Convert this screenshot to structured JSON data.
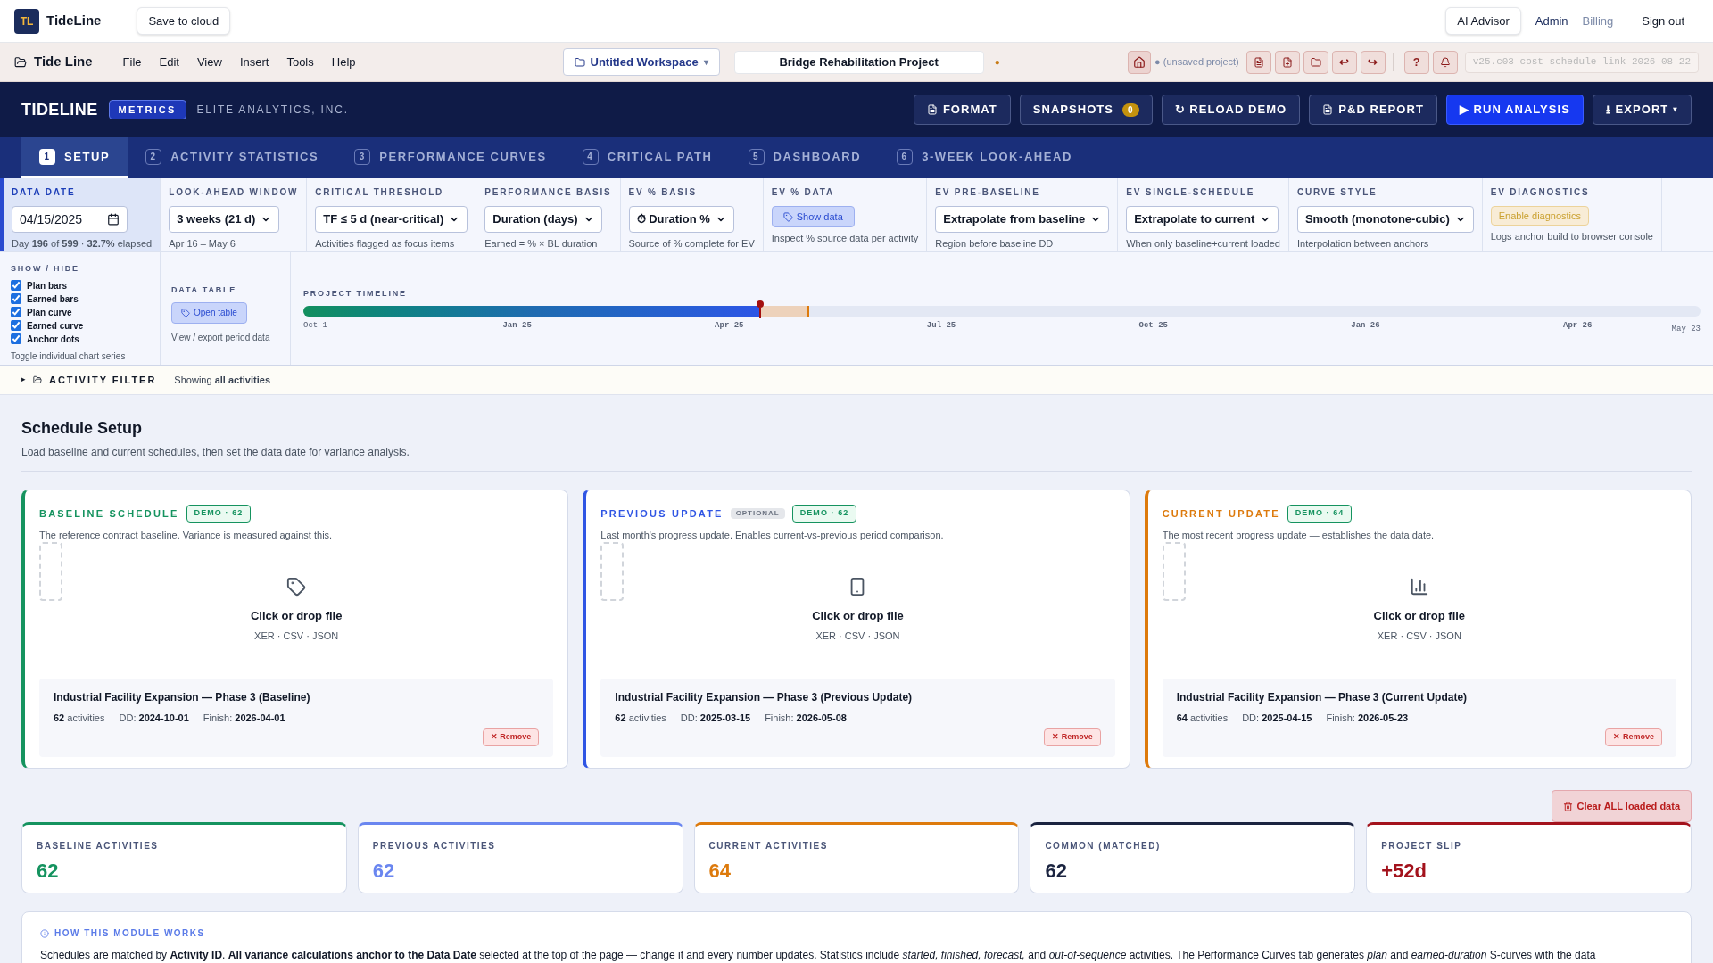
{
  "topbar": {
    "logo": "TL",
    "brand": "TideLine",
    "save_button": "Save to cloud",
    "ai_button": "AI Advisor",
    "links": [
      {
        "label": "Admin",
        "selected": true
      },
      {
        "label": "Billing",
        "selected": false
      }
    ],
    "sign_out": "Sign out"
  },
  "menubar": {
    "app_name": "Tide Line",
    "menus": [
      "File",
      "Edit",
      "View",
      "Insert",
      "Tools",
      "Help"
    ],
    "workspace": "Untitled Workspace",
    "workspace_caret": "▾",
    "project_name": "Bridge Rehabilitation Project",
    "unsaved_dot": "●",
    "status": "● (unsaved project)",
    "tools": [
      {
        "kind": "document"
      },
      {
        "kind": "add-document"
      },
      {
        "kind": "folder"
      },
      {
        "kind": "text",
        "label": "↩"
      },
      {
        "kind": "text",
        "label": "↪"
      },
      {
        "kind": "divider"
      },
      {
        "kind": "text",
        "label": "?"
      },
      {
        "kind": "bell"
      }
    ],
    "version": "v25.c03-cost-schedule-link-2026-08-22"
  },
  "header": {
    "title": "TIDELINE",
    "badge": "METRICS",
    "company": "ELITE ANALYTICS, INC.",
    "buttons": [
      {
        "label": "FORMAT",
        "kind": "icon-doc"
      },
      {
        "label": "SNAPSHOTS",
        "kind": "counter",
        "count": "0"
      },
      {
        "label": "↻ RELOAD DEMO",
        "kind": "plain"
      },
      {
        "label": "P&D REPORT",
        "kind": "icon-doc"
      },
      {
        "label": "▶ RUN ANALYSIS",
        "kind": "primary"
      },
      {
        "label": "⭳ EXPORT ▾",
        "kind": "plain"
      }
    ]
  },
  "tabs": [
    {
      "number": "1",
      "label": "SETUP",
      "selected": true
    },
    {
      "number": "2",
      "label": "ACTIVITY STATISTICS",
      "selected": false
    },
    {
      "number": "3",
      "label": "PERFORMANCE CURVES",
      "selected": false
    },
    {
      "number": "4",
      "label": "CRITICAL PATH",
      "selected": false
    },
    {
      "number": "5",
      "label": "DASHBOARD",
      "selected": false
    },
    {
      "number": "6",
      "label": "3-WEEK LOOK-AHEAD",
      "selected": false
    }
  ],
  "controls": [
    {
      "kind": "date",
      "label": "DATA DATE",
      "value": "04/15/2025",
      "note": "Day **196** of **599** · **32.7%** elapsed"
    },
    {
      "kind": "select",
      "label": "LOOK-AHEAD WINDOW",
      "value": "3 weeks (21 d)",
      "note": "Apr 16 – May 6"
    },
    {
      "kind": "select",
      "label": "CRITICAL THRESHOLD",
      "value": "TF ≤ 5 d (near-critical)",
      "note": "Activities flagged as focus items"
    },
    {
      "kind": "select",
      "label": "PERFORMANCE BASIS",
      "value": "Duration (days)",
      "note": "Earned = % × BL duration"
    },
    {
      "kind": "select",
      "label": "EV % BASIS",
      "value": "⏱ Duration %",
      "note": "Source of % complete for EV"
    },
    {
      "kind": "button",
      "label": "EV % DATA",
      "value": "Show data",
      "note": "Inspect % source data per activity"
    },
    {
      "kind": "select",
      "label": "EV PRE-BASELINE",
      "value": "Extrapolate from baseline",
      "note": "Region before baseline DD"
    },
    {
      "kind": "select",
      "label": "EV SINGLE-SCHEDULE",
      "value": "Extrapolate to current",
      "note": "When only baseline+current loaded"
    },
    {
      "kind": "select",
      "label": "CURVE STYLE",
      "value": "Smooth (monotone-cubic)",
      "note": "Interpolation between anchors"
    },
    {
      "kind": "warn-button",
      "label": "EV DIAGNOSTICS",
      "value": "Enable diagnostics",
      "note": "Logs anchor build to browser console"
    }
  ],
  "show_hide": {
    "label": "SHOW / HIDE",
    "items": [
      {
        "label": "Plan bars",
        "checked": true
      },
      {
        "label": "Earned bars",
        "checked": true
      },
      {
        "label": "Plan curve",
        "checked": true
      },
      {
        "label": "Earned curve",
        "checked": true
      },
      {
        "label": "Anchor dots",
        "checked": true
      }
    ],
    "note": "Toggle individual chart series"
  },
  "data_table": {
    "label": "DATA TABLE",
    "button": "Open table",
    "note": "View / export period data"
  },
  "timeline": {
    "label": "PROJECT TIMELINE",
    "level": 0.327,
    "ticks": [
      "Oct 1",
      "Jan 25",
      "Apr 25",
      "Jul 25",
      "Oct 25",
      "Jan 26",
      "Apr 26"
    ],
    "end_label": "May 23"
  },
  "activity_filter": {
    "toggle": "▸",
    "label": "ACTIVITY FILTER",
    "expanded": false,
    "summary": "Showing **all activities**"
  },
  "setup": {
    "title": "Schedule Setup",
    "subtitle": "Load baseline and current schedules, then set the data date for variance analysis."
  },
  "schedules": [
    {
      "title": "BASELINE SCHEDULE",
      "badge": "DEMO · 62",
      "color": "#15935f",
      "description": "The reference contract baseline. Variance is measured against this.",
      "drop": "Click or drop file",
      "formats": "XER · CSV · JSON",
      "file": "Industrial Facility Expansion — Phase 3 (Baseline)",
      "activities": "62",
      "activities_label": "activities",
      "dd_label": "DD:",
      "dd": "2024-10-01",
      "finish_label": "Finish:",
      "finish": "2026-04-01",
      "remove": "✕ Remove"
    },
    {
      "title": "PREVIOUS UPDATE",
      "optional": "OPTIONAL",
      "badge": "DEMO · 62",
      "color": "#2f55e4",
      "description": "Last month's progress update. Enables current-vs-previous period comparison.",
      "drop": "Click or drop file",
      "formats": "XER · CSV · JSON",
      "file": "Industrial Facility Expansion — Phase 3 (Previous Update)",
      "activities": "62",
      "activities_label": "activities",
      "dd_label": "DD:",
      "dd": "2025-03-15",
      "finish_label": "Finish:",
      "finish": "2026-05-08",
      "remove": "✕ Remove"
    },
    {
      "title": "CURRENT UPDATE",
      "badge": "DEMO · 64",
      "color": "#dd7a0c",
      "description": "The most recent progress update — establishes the data date.",
      "drop": "Click or drop file",
      "formats": "XER · CSV · JSON",
      "file": "Industrial Facility Expansion — Phase 3 (Current Update)",
      "activities": "64",
      "activities_label": "activities",
      "dd_label": "DD:",
      "dd": "2025-04-15",
      "finish_label": "Finish:",
      "finish": "2026-05-23",
      "remove": "✕ Remove"
    }
  ],
  "clear_button": "Clear ALL loaded data",
  "stats": [
    {
      "label": "BASELINE ACTIVITIES",
      "value": "62",
      "color": "#15935f"
    },
    {
      "label": "PREVIOUS ACTIVITIES",
      "value": "62",
      "color": "#6a86f0"
    },
    {
      "label": "CURRENT ACTIVITIES",
      "value": "64",
      "color": "#dd7a0c"
    },
    {
      "label": "COMMON (MATCHED)",
      "value": "62",
      "color": "#1b2440"
    },
    {
      "label": "PROJECT SLIP",
      "value": "+52d",
      "color": "#a3121c"
    }
  ],
  "how": {
    "title": "HOW THIS MODULE WORKS",
    "text": "Schedules are matched by **Activity ID**. **All variance calculations anchor to the Data Date** selected at the top of the page — change it and every number updates. Statistics include *started, finished, forecast,* and *out-of-sequence* activities. The Performance Curves tab generates *plan* and *earned-duration* S-curves with the data"
  }
}
